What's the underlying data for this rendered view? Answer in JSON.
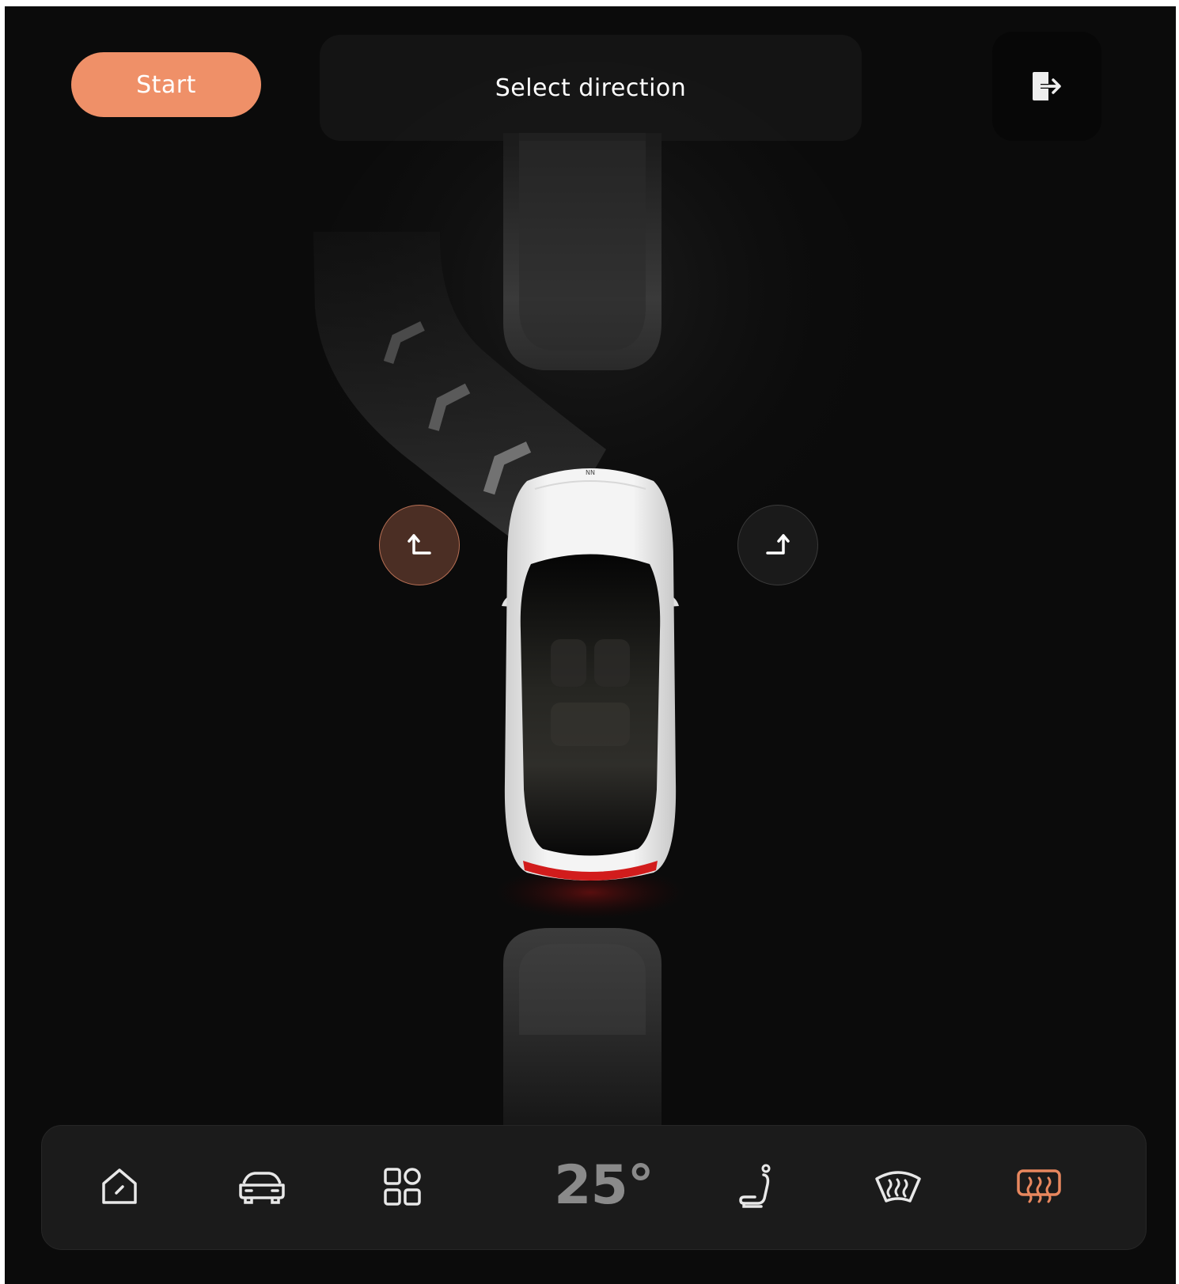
{
  "header": {
    "start_label": "Start",
    "title": "Select direction",
    "exit_icon": "exit-icon"
  },
  "direction_buttons": {
    "left_icon": "turn-left-arrow-icon",
    "right_icon": "turn-right-arrow-icon",
    "selected": "left"
  },
  "bottom_bar": {
    "items": [
      {
        "name": "home",
        "icon": "home-icon"
      },
      {
        "name": "car",
        "icon": "car-icon"
      },
      {
        "name": "apps",
        "icon": "apps-grid-icon"
      },
      {
        "name": "temperature",
        "value": "25°"
      },
      {
        "name": "seat",
        "icon": "seat-icon"
      },
      {
        "name": "front-defrost",
        "icon": "front-defrost-icon"
      },
      {
        "name": "rear-defrost",
        "icon": "rear-defrost-icon",
        "active": true
      }
    ]
  },
  "colors": {
    "accent": "#ef9068",
    "background": "#0b0b0b",
    "icon": "#e8e8e8",
    "active_icon": "#e8875e"
  }
}
